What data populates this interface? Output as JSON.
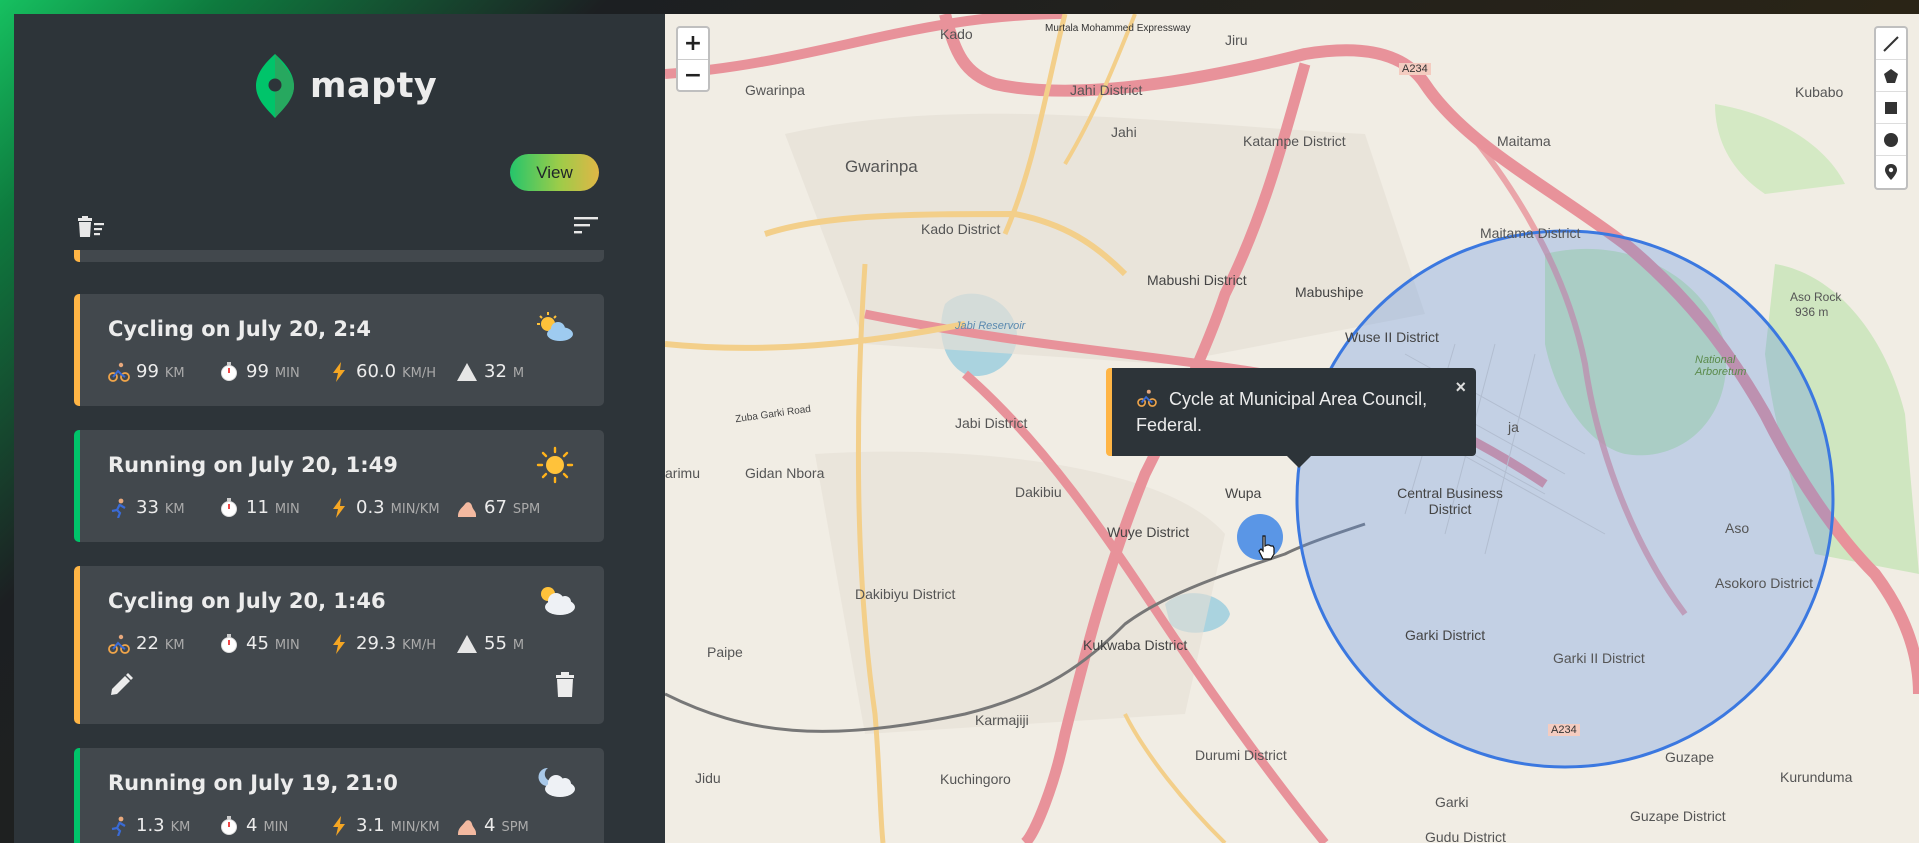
{
  "app": {
    "name": "mapty"
  },
  "sidebar": {
    "view_label": "View",
    "workouts": [
      {
        "type": "cycling",
        "title": "Cycling on July 20, 2:4",
        "weather_icon": "sun-behind-cloud-icon",
        "stats": [
          {
            "icon": "cyclist-icon",
            "value": "99",
            "unit": "KM"
          },
          {
            "icon": "stopwatch-icon",
            "value": "99",
            "unit": "MIN"
          },
          {
            "icon": "lightning-icon",
            "value": "60.0",
            "unit": "KM/H"
          },
          {
            "icon": "elevation-icon",
            "value": "32",
            "unit": "M"
          }
        ]
      },
      {
        "type": "running",
        "title": "Running on July 20, 1:49",
        "weather_icon": "sun-icon",
        "stats": [
          {
            "icon": "runner-icon",
            "value": "33",
            "unit": "KM"
          },
          {
            "icon": "stopwatch-icon",
            "value": "11",
            "unit": "MIN"
          },
          {
            "icon": "lightning-icon",
            "value": "0.3",
            "unit": "MIN/KM"
          },
          {
            "icon": "footprint-icon",
            "value": "67",
            "unit": "SPM"
          }
        ]
      },
      {
        "type": "cycling",
        "title": "Cycling on July 20, 1:46",
        "weather_icon": "sun-behind-large-cloud-icon",
        "stats": [
          {
            "icon": "cyclist-icon",
            "value": "22",
            "unit": "KM"
          },
          {
            "icon": "stopwatch-icon",
            "value": "45",
            "unit": "MIN"
          },
          {
            "icon": "lightning-icon",
            "value": "29.3",
            "unit": "KM/H"
          },
          {
            "icon": "elevation-icon",
            "value": "55",
            "unit": "M"
          }
        ],
        "actions": [
          "edit-icon",
          "delete-icon"
        ]
      },
      {
        "type": "running",
        "title": "Running on July 19, 21:0",
        "weather_icon": "moon-cloud-icon",
        "stats": [
          {
            "icon": "runner-icon",
            "value": "1.3",
            "unit": "KM"
          },
          {
            "icon": "stopwatch-icon",
            "value": "4",
            "unit": "MIN"
          },
          {
            "icon": "lightning-icon",
            "value": "3.1",
            "unit": "MIN/KM"
          },
          {
            "icon": "footprint-icon",
            "value": "4",
            "unit": "SPM"
          }
        ]
      }
    ]
  },
  "map": {
    "zoom_in": "+",
    "zoom_out": "−",
    "popup_text": "Cycle at Municipal Area Council, Federal.",
    "popup_close": "×",
    "labels": {
      "kado": "Kado",
      "jiru": "Jiru",
      "murtala": "Murtala Mohammed Expressway",
      "a234_top": "A234",
      "kubabo": "Kubabo",
      "gwarinpa_small": "Gwarinpa",
      "jahi_district": "Jahi District",
      "gwarinpa": "Gwarinpa",
      "jahi": "Jahi",
      "katampe_district": "Katampe District",
      "maitama": "Maitama",
      "kado_district": "Kado District",
      "maitama_district": "Maitama District",
      "mabushi_district": "Mabushi District",
      "mabushipe": "Mabushipe",
      "wuse_ii": "Wuse II District",
      "aso_rock": "Aso Rock",
      "aso_elev": "936 m",
      "national_arboretum": "National Arboretum",
      "jabi_reservoir": "Jabi Reservoir",
      "jabi_district": "Jabi District",
      "zuba_garki": "Zuba Garki Road",
      "arimu": "arimu",
      "gidan_nbora": "Gidan Nbora",
      "dakibiu": "Dakibiu",
      "wupa": "Wupa",
      "cbd": "Central Business District",
      "wuye_district": "Wuye District",
      "aso": "Aso",
      "asokoro": "Asokoro District",
      "dakibiyu_district": "Dakibiyu District",
      "paipe": "Paipe",
      "kukwaba_district": "Kukwaba District",
      "garki_district": "Garki District",
      "garki_ii": "Garki II District",
      "karmajiji": "Karmajiji",
      "a234_bottom": "A234",
      "guzape": "Guzape",
      "kurunduma": "Kurunduma",
      "jidu": "Jidu",
      "kuchingoro": "Kuchingoro",
      "durumi_district": "Durumi District",
      "garki": "Garki",
      "guzape_district": "Guzape District",
      "gudu_district": "Gudu District",
      "ja": "ja"
    }
  }
}
